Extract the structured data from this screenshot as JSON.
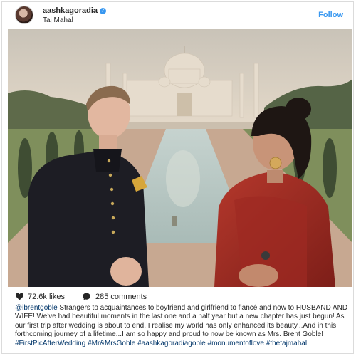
{
  "post": {
    "username": "aashkagoradia",
    "location": "Taj Mahal",
    "follow_label": "Follow",
    "likes": "72.6k likes",
    "comments": "285 comments",
    "caption_mention": "@ibrentgoble",
    "caption_text": " Strangers to acquaintances to boyfriend and girlfriend to fiancé and now to HUSBAND AND WIFE! We've had beautiful moments in the last one and a half year but a new chapter has just begun! As our first trip after wedding is about to end, I realise my world has only enhanced its beauty...And in this forthcoming journey of a lifetime...I am so happy and proud to now be known as Mrs. Brent Goble! ",
    "caption_hashtags": "#FirstPicAfterWedding #Mr&MrsGoble #aashkagoradiagoble #monumentoflove #thetajmahal",
    "colors": {
      "accent": "#3897f0",
      "text": "#262626",
      "hashtag": "#003569"
    }
  }
}
